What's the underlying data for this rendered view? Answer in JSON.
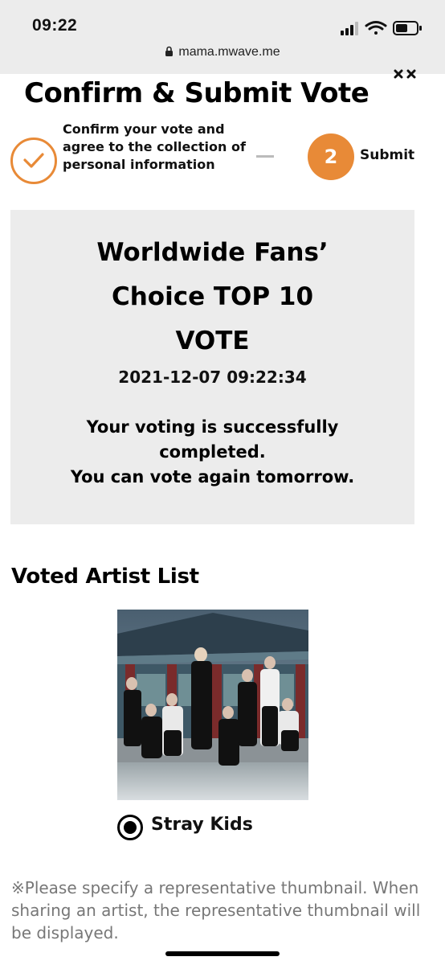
{
  "status_bar": {
    "time": "09:22",
    "url": "mama.mwave.me",
    "icons": [
      "signal-icon",
      "wifi-icon",
      "battery-icon"
    ]
  },
  "page": {
    "title": "Confirm & Submit Vote"
  },
  "steps": [
    {
      "label": "Confirm your vote and agree to the collection of personal information",
      "state": "done",
      "icon": "check-icon"
    },
    {
      "number": "2",
      "label": "Submit",
      "state": "active"
    }
  ],
  "result": {
    "title_lines": [
      "Worldwide Fans’",
      "Choice TOP 10",
      "VOTE"
    ],
    "timestamp": "2021-12-07 09:22:34",
    "message_lines": [
      "Your voting is successfully",
      "completed.",
      "You can vote again tomorrow."
    ]
  },
  "voted_list": {
    "title": "Voted Artist List",
    "artists": [
      {
        "name": "Stray Kids",
        "selected": true
      }
    ]
  },
  "note": "※Please specify a representative thumbnail. When sharing an artist, the representative thumbnail will be displayed.",
  "colors": {
    "accent": "#e88a37",
    "panel": "#ececec",
    "note_text": "#777777"
  }
}
